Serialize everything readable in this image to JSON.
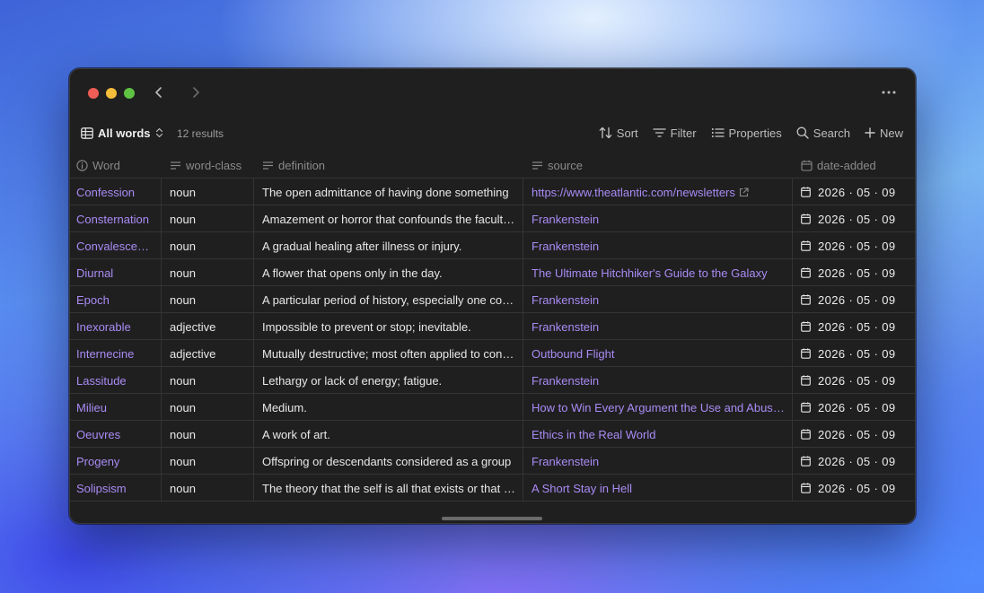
{
  "toolbar": {
    "view_label": "All words",
    "results": "12 results",
    "sort": "Sort",
    "filter": "Filter",
    "properties": "Properties",
    "search": "Search",
    "new": "New"
  },
  "columns": {
    "word": "Word",
    "word_class": "word-class",
    "definition": "definition",
    "source": "source",
    "date_added": "date-added"
  },
  "rows": [
    {
      "word": "Confession",
      "word_class": "noun",
      "definition": "The open admittance of having done something",
      "source": "https://www.theatlantic.com/newsletters",
      "date": "2026 · 05 · 09"
    },
    {
      "word": "Consternation",
      "word_class": "noun",
      "definition": "Amazement or horror that confounds the faculties",
      "source": "Frankenstein",
      "date": "2026 · 05 · 09"
    },
    {
      "word": "Convalescence",
      "word_class": "noun",
      "definition": "A gradual healing after illness or injury.",
      "source": "Frankenstein",
      "date": "2026 · 05 · 09"
    },
    {
      "word": "Diurnal",
      "word_class": "noun",
      "definition": "A flower that opens only in the day.",
      "source": "The Ultimate Hitchhiker's Guide to the Galaxy",
      "date": "2026 · 05 · 09"
    },
    {
      "word": "Epoch",
      "word_class": "noun",
      "definition": "A particular period of history, especially one considered",
      "source": "Frankenstein",
      "date": "2026 · 05 · 09"
    },
    {
      "word": "Inexorable",
      "word_class": "adjective",
      "definition": "Impossible to prevent or stop; inevitable.",
      "source": "Frankenstein",
      "date": "2026 · 05 · 09"
    },
    {
      "word": "Internecine",
      "word_class": "adjective",
      "definition": "Mutually destructive; most often applied to conflict",
      "source": "Outbound Flight",
      "date": "2026 · 05 · 09"
    },
    {
      "word": "Lassitude",
      "word_class": "noun",
      "definition": "Lethargy or lack of energy; fatigue.",
      "source": "Frankenstein",
      "date": "2026 · 05 · 09"
    },
    {
      "word": "Milieu",
      "word_class": "noun",
      "definition": "Medium.",
      "source": "How to Win Every Argument the Use and Abuse of Logic",
      "date": "2026 · 05 · 09"
    },
    {
      "word": "Oeuvres",
      "word_class": "noun",
      "definition": "A work of art.",
      "source": "Ethics in the Real World",
      "date": "2026 · 05 · 09"
    },
    {
      "word": "Progeny",
      "word_class": "noun",
      "definition": "Offspring or descendants considered as a group",
      "source": "Frankenstein",
      "date": "2026 · 05 · 09"
    },
    {
      "word": "Solipsism",
      "word_class": "noun",
      "definition": "The theory that the self is all that exists or that can be known",
      "source": "A Short Stay in Hell",
      "date": "2026 · 05 · 09"
    }
  ],
  "colors": {
    "accent": "#a98bf5",
    "window_bg": "#1f1f1f"
  }
}
